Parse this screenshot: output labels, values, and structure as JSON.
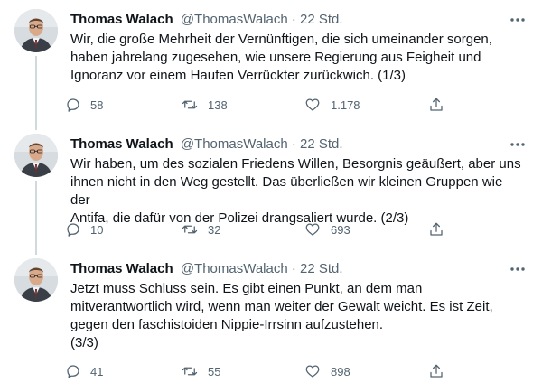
{
  "tweets": [
    {
      "name": "Thomas Walach",
      "handle": "@ThomasWalach",
      "separator": "·",
      "time": "22 Std.",
      "text": "Wir, die große Mehrheit der Vernünftigen, die sich umeinander sorgen,\nhaben jahrelang zugesehen, wie unsere Regierung aus Feigheit und\nIgnoranz vor einem Haufen Verrückter zurückwich. (1/3)",
      "replies": "58",
      "retweets": "138",
      "likes": "1.178"
    },
    {
      "name": "Thomas Walach",
      "handle": "@ThomasWalach",
      "separator": "·",
      "time": "22 Std.",
      "text": "Wir haben, um des sozialen Friedens Willen, Besorgnis geäußert, aber uns\nihnen nicht in den Weg gestellt. Das überließen wir kleinen Gruppen wie der\nAntifa, die dafür von der Polizei drangsaliert wurde. (2/3)",
      "replies": "10",
      "retweets": "32",
      "likes": "693"
    },
    {
      "name": "Thomas Walach",
      "handle": "@ThomasWalach",
      "separator": "·",
      "time": "22 Std.",
      "text": "Jetzt muss Schluss sein. Es gibt einen Punkt, an dem man\nmitverantwortlich wird, wenn man weiter der Gewalt weicht. Es ist Zeit,\ngegen den faschistoiden Nippie-Irrsinn aufzustehen.\n(3/3)",
      "replies": "41",
      "retweets": "55",
      "likes": "898"
    }
  ],
  "icons": {
    "more": "more-horizontal-icon",
    "reply": "reply-icon",
    "retweet": "retweet-icon",
    "like": "heart-icon",
    "share": "share-icon"
  },
  "colors": {
    "text": "#0f1419",
    "secondary": "#536471",
    "thread_line": "#cfd9de",
    "background": "#ffffff"
  }
}
